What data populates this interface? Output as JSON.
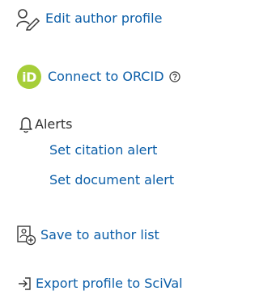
{
  "actions": {
    "edit_profile": {
      "label": "Edit author profile",
      "icon": "edit-profile-icon"
    },
    "connect_orcid": {
      "label": "Connect to ORCID",
      "badge": "iD",
      "icon": "orcid-icon",
      "help_icon": "help-icon"
    },
    "alerts": {
      "label": "Alerts",
      "icon": "bell-icon",
      "items": [
        {
          "label": "Set citation alert"
        },
        {
          "label": "Set document alert"
        }
      ]
    },
    "save_to_list": {
      "label": "Save to author list",
      "icon": "save-to-list-icon"
    },
    "export_scival": {
      "label": "Export profile to SciVal",
      "icon": "export-icon"
    }
  },
  "colors": {
    "link": "#0b5ea8",
    "text": "#2e2e2e",
    "orcid": "#a6ce39"
  }
}
